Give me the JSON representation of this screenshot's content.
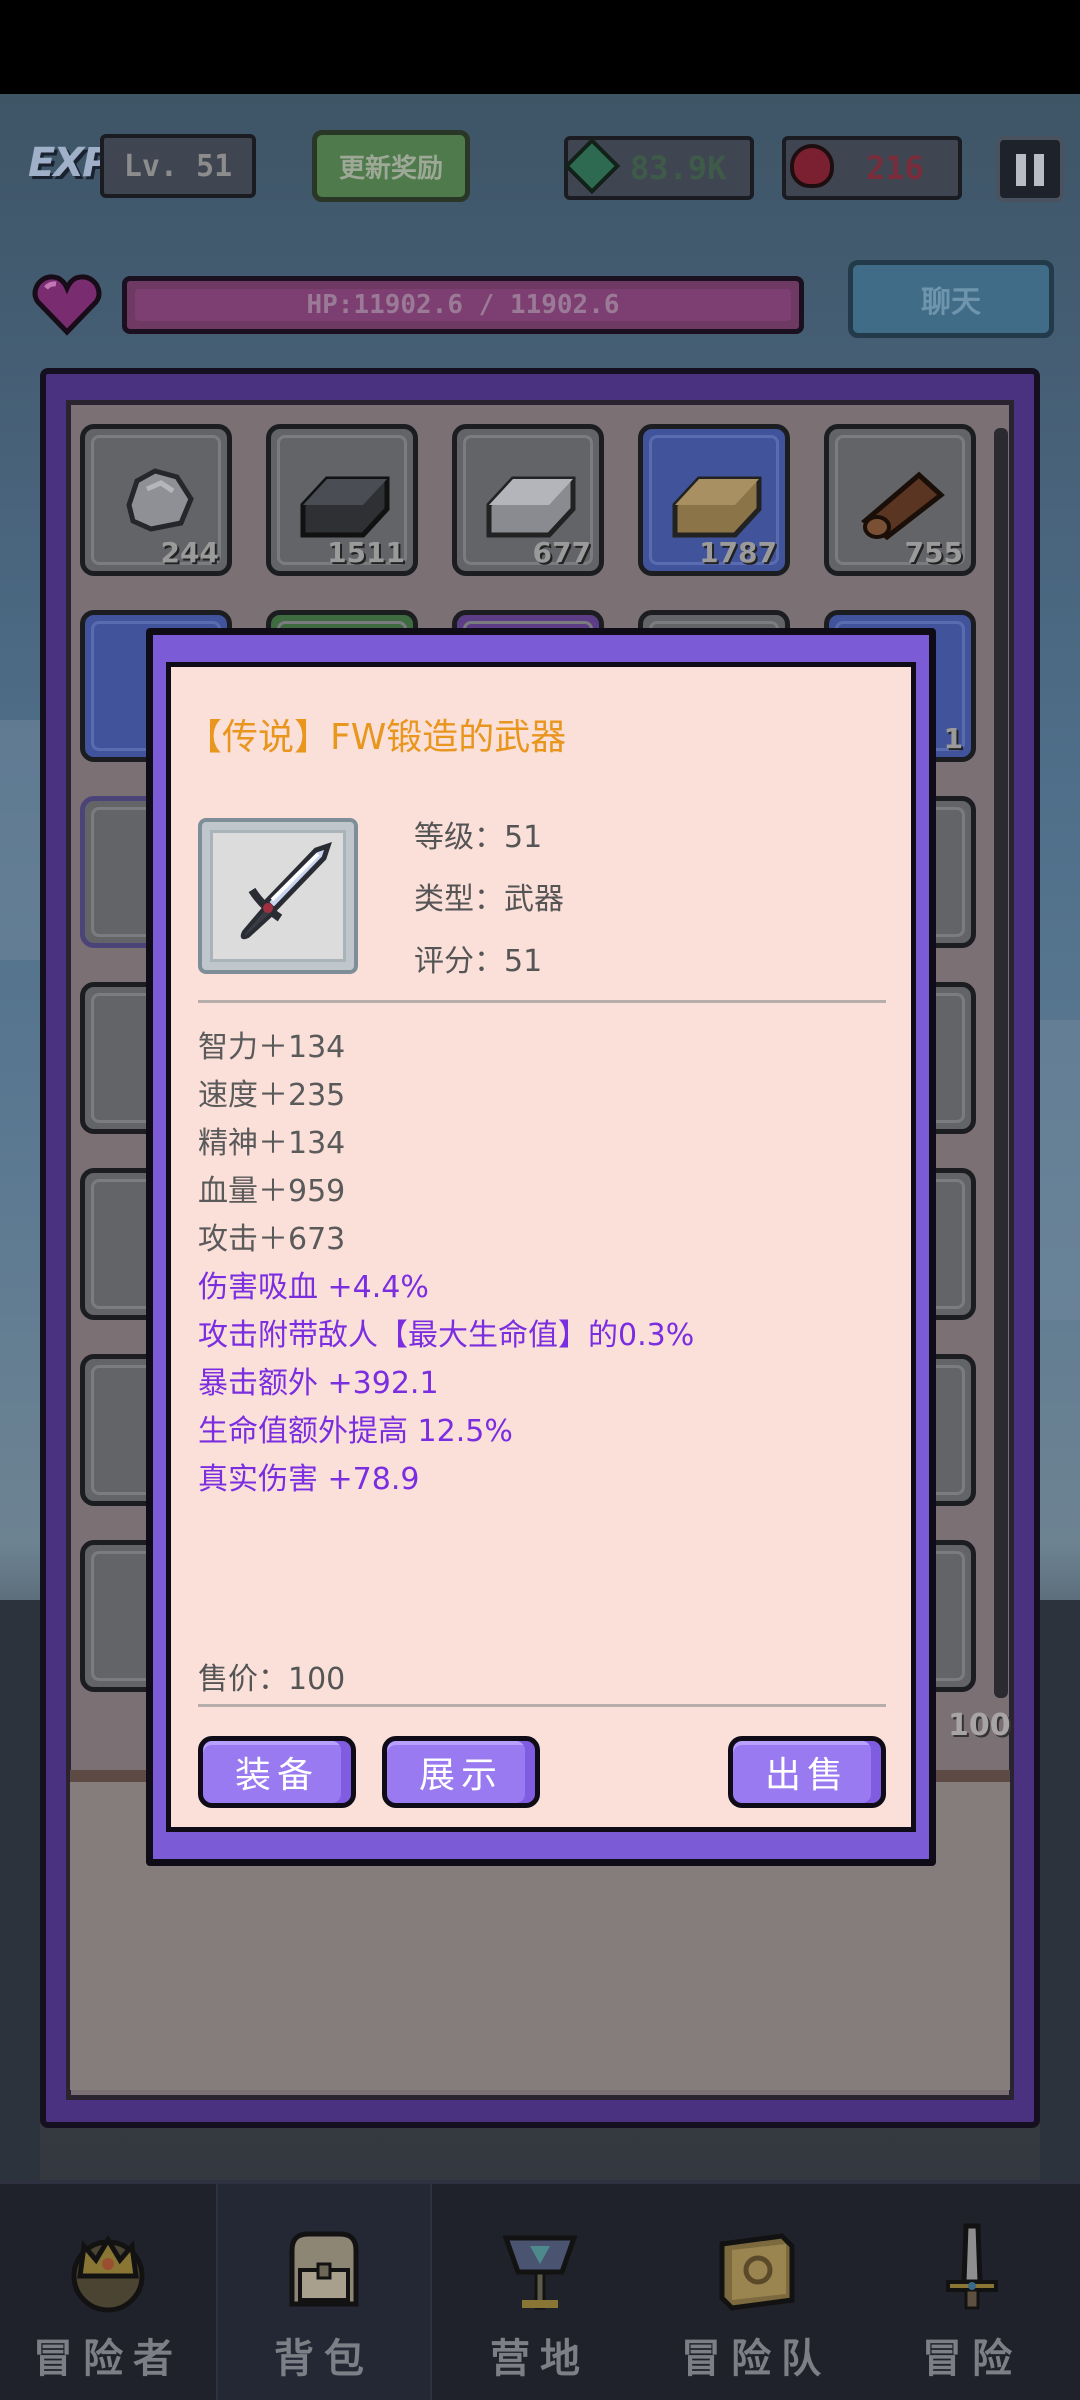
{
  "hud": {
    "exp_label": "EXP",
    "level": "Lv. 51",
    "refresh_button": "更新奖励",
    "gems": "83.9K",
    "rubies": "216",
    "hp": "HP:11902.6 / 11902.6",
    "chat_button": "聊天"
  },
  "inventory": {
    "row1_counts": [
      "244",
      "1511",
      "677",
      "1787",
      "755"
    ],
    "row2_last_count": "1",
    "bottom_right_count": "100"
  },
  "popup": {
    "title": "【传说】FW锻造的武器",
    "level": "等级：51",
    "type": "类型：武器",
    "score": "评分：51",
    "base_stats": [
      "智力＋134",
      "速度＋235",
      "精神＋134",
      "血量＋959",
      "攻击＋673"
    ],
    "special_stats": [
      "伤害吸血 +4.4%",
      "攻击附带敌人【最大生命值】的0.3%",
      "暴击额外 +392.1",
      "生命值额外提高 12.5%",
      "真实伤害 +78.9"
    ],
    "price": "售价：100",
    "equip_button": "装备",
    "show_button": "展示",
    "sell_button": "出售",
    "title_color": "#e8961e",
    "special_color": "#7b2ee0",
    "button_color": "#9a7af0"
  },
  "nav": {
    "items": [
      "冒险者",
      "背包",
      "营地",
      "冒险队",
      "冒险"
    ],
    "active": "背包"
  }
}
